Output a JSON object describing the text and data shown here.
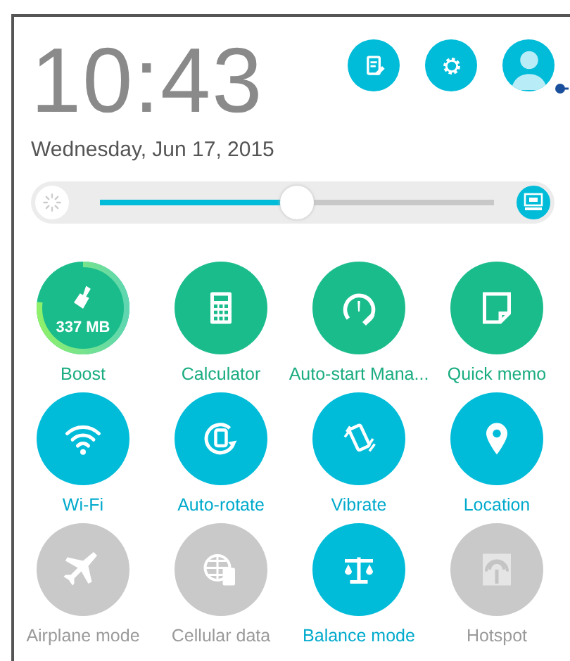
{
  "clock": {
    "time": "10:43",
    "date": "Wednesday, Jun 17, 2015"
  },
  "header_buttons": [
    {
      "kind": "edit"
    },
    {
      "kind": "settings"
    },
    {
      "kind": "profile"
    }
  ],
  "brightness": {
    "level": 0.5,
    "auto": true
  },
  "tiles": [
    {
      "label": "Boost",
      "kind": "app",
      "badge": "337 MB"
    },
    {
      "label": "Calculator",
      "kind": "app"
    },
    {
      "label": "Auto-start Mana...",
      "kind": "app"
    },
    {
      "label": "Quick memo",
      "kind": "app"
    },
    {
      "label": "Wi-Fi",
      "kind": "toggle",
      "on": true
    },
    {
      "label": "Auto-rotate",
      "kind": "toggle",
      "on": true
    },
    {
      "label": "Vibrate",
      "kind": "toggle",
      "on": true
    },
    {
      "label": "Location",
      "kind": "toggle",
      "on": true
    },
    {
      "label": "Airplane mode",
      "kind": "toggle",
      "on": false
    },
    {
      "label": "Cellular data",
      "kind": "toggle",
      "on": false
    },
    {
      "label": "Balance mode",
      "kind": "toggle",
      "on": true
    },
    {
      "label": "Hotspot",
      "kind": "toggle",
      "on": false
    }
  ]
}
